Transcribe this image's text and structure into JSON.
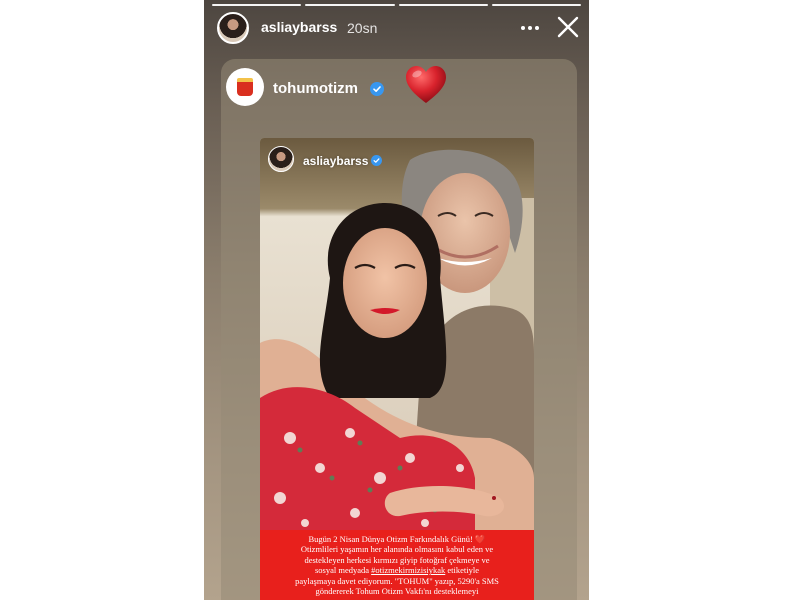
{
  "story": {
    "username": "asliaybarss",
    "time": "20sn",
    "progress_segments": [
      true,
      true,
      true,
      true
    ]
  },
  "icons": {
    "more": "more-horizontal-icon",
    "close": "close-icon",
    "verified": "verified-badge-icon",
    "sticker": "heart-icon"
  },
  "repost": {
    "account": "tohumotizm",
    "post": {
      "username": "asliaybarss",
      "caption": {
        "line1": "Bugün 2 Nisan Dünya Otizm Farkındalık Günü! ❤️",
        "line2": "Otizmlileri yaşamın her alanında olmasını kabul eden ve",
        "line3": "destekleyen herkesi kırmızı giyip fotoğraf çekmeye ve",
        "line4_prefix": "sosyal medyada",
        "hashtag": "#otizmekirmizisiykak",
        "line4_suffix": "etiketiyle",
        "line5": "paylaşmaya davet ediyorum. \"TOHUM\" yazıp, 5290'a SMS",
        "line6": "göndererek Tohum Otizm Vakfı'nı desteklemeyi"
      }
    }
  },
  "colors": {
    "verified_blue": "#3897f0",
    "caption_red": "#e8201c",
    "heart_red": "#d8222c"
  }
}
